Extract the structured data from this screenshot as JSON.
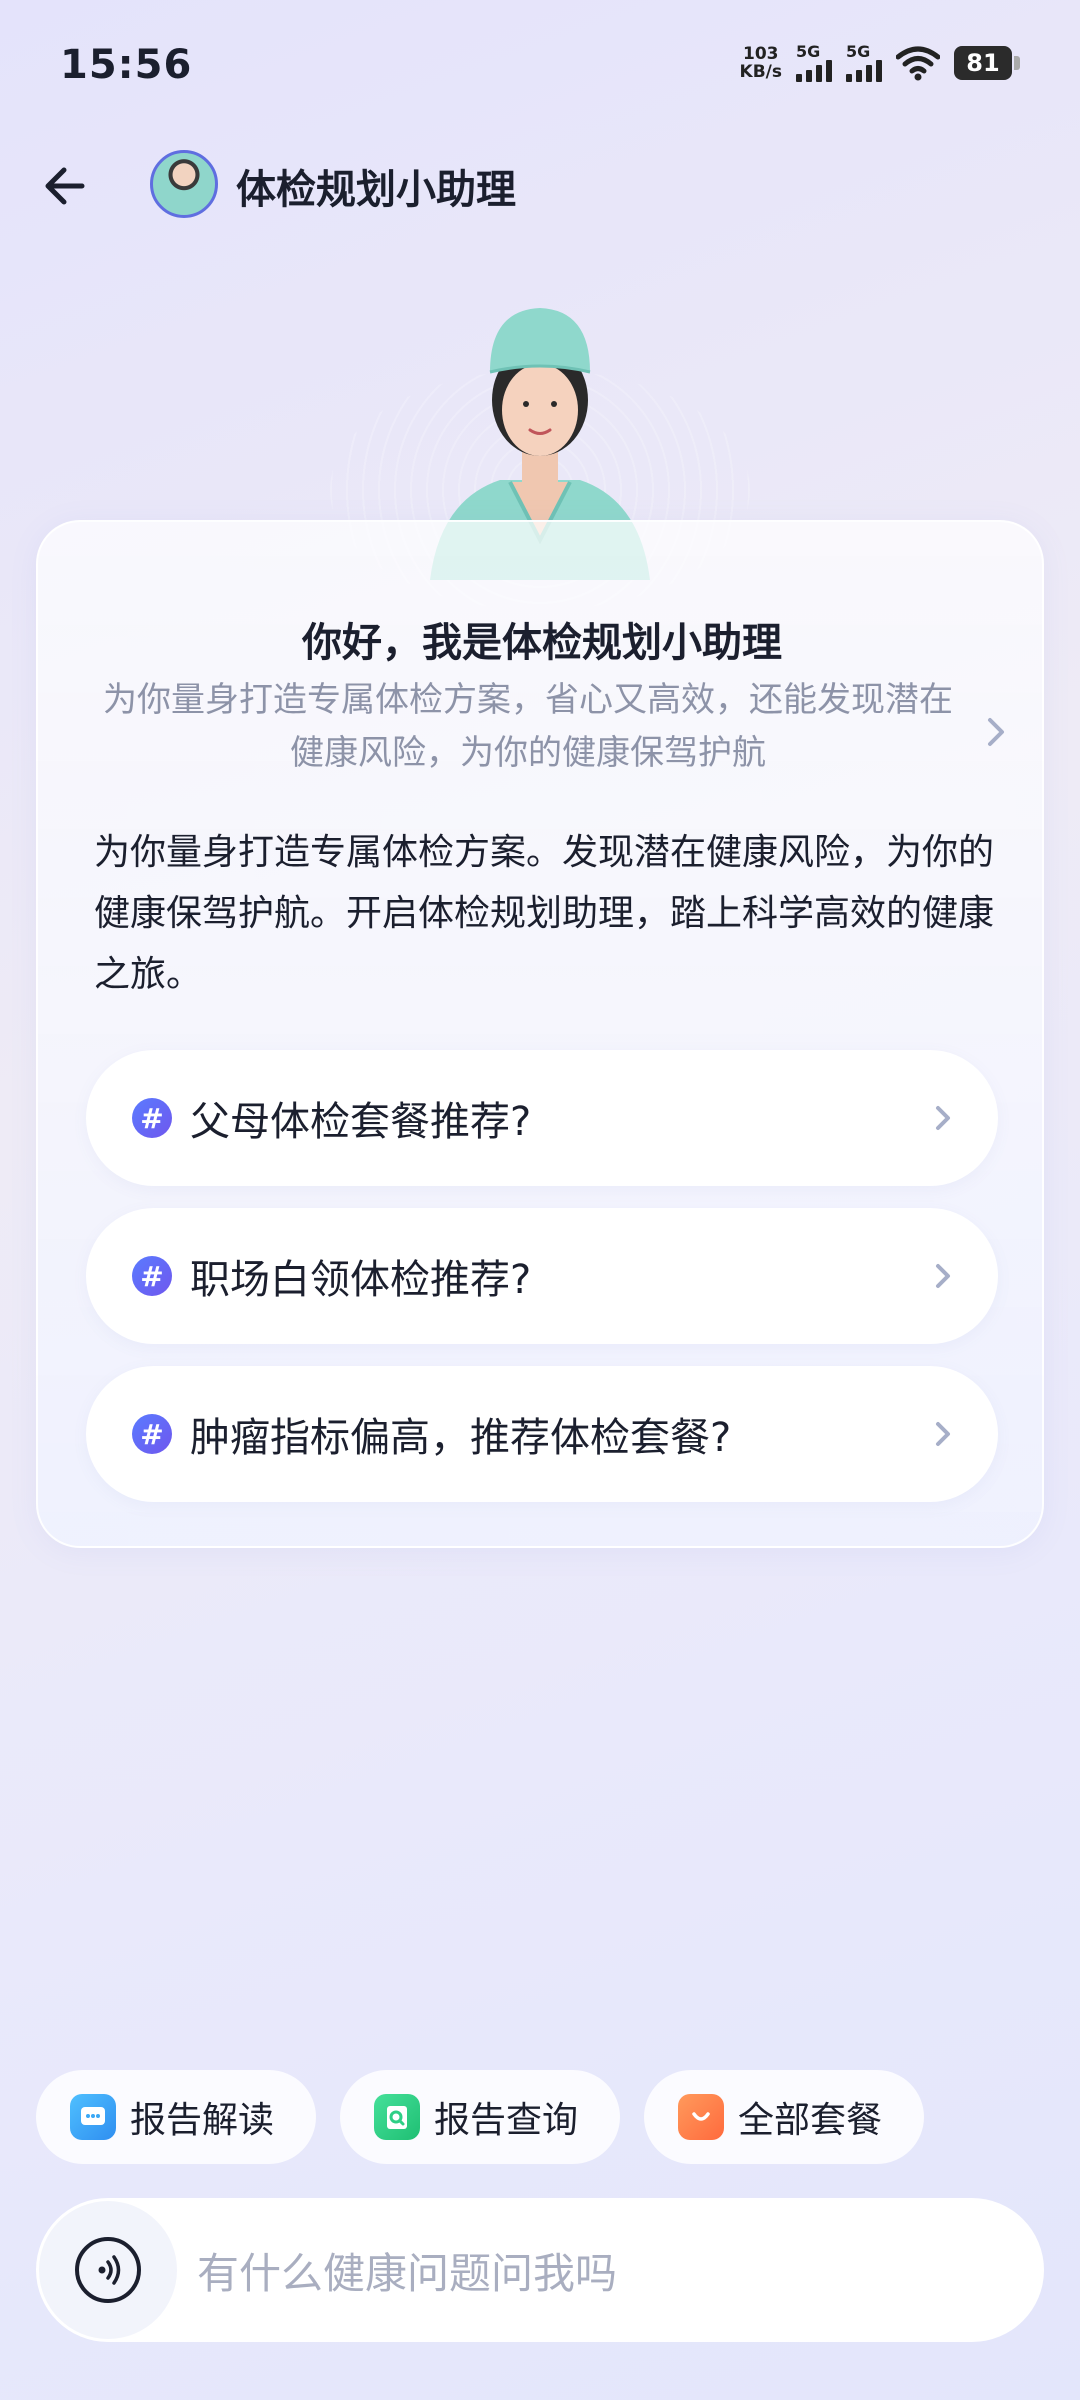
{
  "status_bar": {
    "time": "15:56",
    "speed_value": "103",
    "speed_unit": "KB/s",
    "sim1": "5G",
    "sim2": "5G",
    "battery": "81"
  },
  "header": {
    "title": "体检规划小助理",
    "back_icon": "back-arrow-icon",
    "avatar": "assistant-avatar"
  },
  "card": {
    "greeting": "你好，我是体检规划小助理",
    "subtitle": "为你量身打造专属体检方案，省心又高效，还能发现潜在健康风险，为你的健康保驾护航",
    "body": "为你量身打造专属体检方案。发现潜在健康风险，为你的健康保驾护航。开启体检规划助理，踏上科学高效的健康之旅。",
    "suggestions": [
      {
        "label": "父母体检套餐推荐?"
      },
      {
        "label": "职场白领体检推荐?"
      },
      {
        "label": "肿瘤指标偏高，推荐体检套餐?"
      }
    ]
  },
  "quick_actions": [
    {
      "label": "报告解读",
      "color": "#3aa8f5"
    },
    {
      "label": "报告查询",
      "color": "#2fcf86"
    },
    {
      "label": "全部套餐",
      "color": "#ff7a45"
    }
  ],
  "input": {
    "placeholder": "有什么健康问题问我吗"
  },
  "colors": {
    "accent": "#5f6ee0",
    "hash_badge": "#6266f1",
    "text_primary": "#1b1f2e",
    "text_secondary": "#8d93a8"
  }
}
